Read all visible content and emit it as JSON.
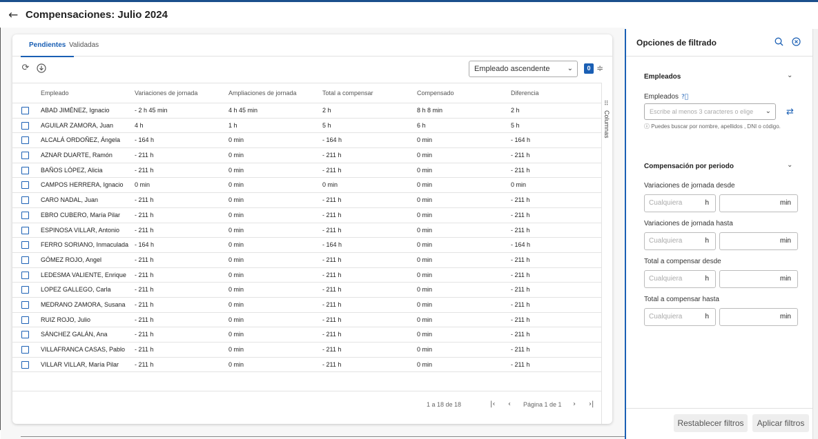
{
  "page": {
    "title": "Compensaciones: Julio 2024",
    "back_icon": "arrow-left-icon"
  },
  "tabs": [
    {
      "label": "Pendientes",
      "active": true
    },
    {
      "label": "Validadas",
      "active": false
    }
  ],
  "toolbar": {
    "refresh_icon": "refresh-icon",
    "download_icon": "download-icon",
    "sort_value": "Empleado ascendente",
    "filter_count": "0",
    "columns_label": "Columnas"
  },
  "table": {
    "columns": [
      "Empleado",
      "Variaciones de jornada",
      "Ampliaciones de jornada",
      "Total a compensar",
      "Compensado",
      "Diferencia"
    ],
    "rows": [
      [
        "ABAD JIMÉNEZ, Ignacio",
        "- 2 h 45 min",
        "4 h 45 min",
        "2 h",
        "8 h 8 min",
        "2 h"
      ],
      [
        "AGUILAR ZAMORA, Juan",
        "4 h",
        "1 h",
        "5 h",
        "6 h",
        "5 h"
      ],
      [
        "ALCALÁ ORDOÑEZ, Ángela",
        "- 164 h",
        "0 min",
        "- 164 h",
        "0 min",
        "- 164 h"
      ],
      [
        "AZNAR DUARTE, Ramón",
        "- 211 h",
        "0 min",
        "- 211 h",
        "0 min",
        "- 211 h"
      ],
      [
        "BAÑOS LÓPEZ, Alicia",
        "- 211 h",
        "0 min",
        "- 211 h",
        "0 min",
        "- 211 h"
      ],
      [
        "CAMPOS HERRERA, Ignacio",
        "0 min",
        "0 min",
        "0 min",
        "0 min",
        "0 min"
      ],
      [
        "CARO NADAL, Juan",
        "- 211 h",
        "0 min",
        "- 211 h",
        "0 min",
        "- 211 h"
      ],
      [
        "EBRO CUBERO, María Pilar",
        "- 211 h",
        "0 min",
        "- 211 h",
        "0 min",
        "- 211 h"
      ],
      [
        "ESPINOSA VILLAR, Antonio",
        "- 211 h",
        "0 min",
        "- 211 h",
        "0 min",
        "- 211 h"
      ],
      [
        "FERRO SORIANO, Inmaculada",
        "- 164 h",
        "0 min",
        "- 164 h",
        "0 min",
        "- 164 h"
      ],
      [
        "GÓMEZ ROJO, Angel",
        "- 211 h",
        "0 min",
        "- 211 h",
        "0 min",
        "- 211 h"
      ],
      [
        "LEDESMA VALIENTE, Enrique",
        "- 211 h",
        "0 min",
        "- 211 h",
        "0 min",
        "- 211 h"
      ],
      [
        "LOPEZ GALLEGO, Carla",
        "- 211 h",
        "0 min",
        "- 211 h",
        "0 min",
        "- 211 h"
      ],
      [
        "MEDRANO ZAMORA, Susana",
        "- 211 h",
        "0 min",
        "- 211 h",
        "0 min",
        "- 211 h"
      ],
      [
        "RUIZ ROJO, Julio",
        "- 211 h",
        "0 min",
        "- 211 h",
        "0 min",
        "- 211 h"
      ],
      [
        "SÁNCHEZ GALÁN, Ana",
        "- 211 h",
        "0 min",
        "- 211 h",
        "0 min",
        "- 211 h"
      ],
      [
        "VILLAFRANCA CASAS, Pablo",
        "- 211 h",
        "0 min",
        "- 211 h",
        "0 min",
        "- 211 h"
      ],
      [
        "VILLAR VILLAR, María Pilar",
        "- 211 h",
        "0 min",
        "- 211 h",
        "0 min",
        "- 211 h"
      ]
    ]
  },
  "pagination": {
    "range": "1 a 18 de 18",
    "page": "Página 1 de 1"
  },
  "sidebar": {
    "title": "Opciones de filtrado",
    "employees_section": "Empleados",
    "employees_label": "Empleados",
    "employees_placeholder": "Escribe al menos 3 caracteres o elige",
    "employees_hint": "ⓘ Puedes buscar por nombre, apellidos , DNI o código.",
    "period_section": "Compensación por periodo",
    "fields": [
      {
        "label": "Variaciones de jornada desde"
      },
      {
        "label": "Variaciones de jornada hasta"
      },
      {
        "label": "Total a compensar desde"
      },
      {
        "label": "Total a compensar hasta"
      }
    ],
    "hours_placeholder": "Cualquiera",
    "hours_unit": "h",
    "minutes_unit": "min",
    "reset_button": "Restablecer filtros",
    "apply_button": "Aplicar filtros"
  }
}
